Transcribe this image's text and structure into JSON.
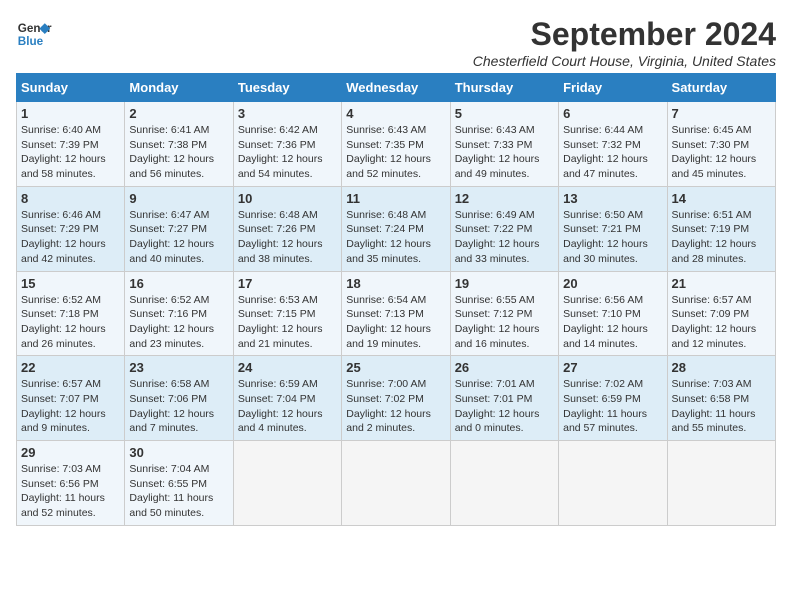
{
  "header": {
    "logo_line1": "General",
    "logo_line2": "Blue",
    "title": "September 2024",
    "subtitle": "Chesterfield Court House, Virginia, United States"
  },
  "days_of_week": [
    "Sunday",
    "Monday",
    "Tuesday",
    "Wednesday",
    "Thursday",
    "Friday",
    "Saturday"
  ],
  "weeks": [
    [
      {
        "day": "1",
        "info": "Sunrise: 6:40 AM\nSunset: 7:39 PM\nDaylight: 12 hours\nand 58 minutes."
      },
      {
        "day": "2",
        "info": "Sunrise: 6:41 AM\nSunset: 7:38 PM\nDaylight: 12 hours\nand 56 minutes."
      },
      {
        "day": "3",
        "info": "Sunrise: 6:42 AM\nSunset: 7:36 PM\nDaylight: 12 hours\nand 54 minutes."
      },
      {
        "day": "4",
        "info": "Sunrise: 6:43 AM\nSunset: 7:35 PM\nDaylight: 12 hours\nand 52 minutes."
      },
      {
        "day": "5",
        "info": "Sunrise: 6:43 AM\nSunset: 7:33 PM\nDaylight: 12 hours\nand 49 minutes."
      },
      {
        "day": "6",
        "info": "Sunrise: 6:44 AM\nSunset: 7:32 PM\nDaylight: 12 hours\nand 47 minutes."
      },
      {
        "day": "7",
        "info": "Sunrise: 6:45 AM\nSunset: 7:30 PM\nDaylight: 12 hours\nand 45 minutes."
      }
    ],
    [
      {
        "day": "8",
        "info": "Sunrise: 6:46 AM\nSunset: 7:29 PM\nDaylight: 12 hours\nand 42 minutes."
      },
      {
        "day": "9",
        "info": "Sunrise: 6:47 AM\nSunset: 7:27 PM\nDaylight: 12 hours\nand 40 minutes."
      },
      {
        "day": "10",
        "info": "Sunrise: 6:48 AM\nSunset: 7:26 PM\nDaylight: 12 hours\nand 38 minutes."
      },
      {
        "day": "11",
        "info": "Sunrise: 6:48 AM\nSunset: 7:24 PM\nDaylight: 12 hours\nand 35 minutes."
      },
      {
        "day": "12",
        "info": "Sunrise: 6:49 AM\nSunset: 7:22 PM\nDaylight: 12 hours\nand 33 minutes."
      },
      {
        "day": "13",
        "info": "Sunrise: 6:50 AM\nSunset: 7:21 PM\nDaylight: 12 hours\nand 30 minutes."
      },
      {
        "day": "14",
        "info": "Sunrise: 6:51 AM\nSunset: 7:19 PM\nDaylight: 12 hours\nand 28 minutes."
      }
    ],
    [
      {
        "day": "15",
        "info": "Sunrise: 6:52 AM\nSunset: 7:18 PM\nDaylight: 12 hours\nand 26 minutes."
      },
      {
        "day": "16",
        "info": "Sunrise: 6:52 AM\nSunset: 7:16 PM\nDaylight: 12 hours\nand 23 minutes."
      },
      {
        "day": "17",
        "info": "Sunrise: 6:53 AM\nSunset: 7:15 PM\nDaylight: 12 hours\nand 21 minutes."
      },
      {
        "day": "18",
        "info": "Sunrise: 6:54 AM\nSunset: 7:13 PM\nDaylight: 12 hours\nand 19 minutes."
      },
      {
        "day": "19",
        "info": "Sunrise: 6:55 AM\nSunset: 7:12 PM\nDaylight: 12 hours\nand 16 minutes."
      },
      {
        "day": "20",
        "info": "Sunrise: 6:56 AM\nSunset: 7:10 PM\nDaylight: 12 hours\nand 14 minutes."
      },
      {
        "day": "21",
        "info": "Sunrise: 6:57 AM\nSunset: 7:09 PM\nDaylight: 12 hours\nand 12 minutes."
      }
    ],
    [
      {
        "day": "22",
        "info": "Sunrise: 6:57 AM\nSunset: 7:07 PM\nDaylight: 12 hours\nand 9 minutes."
      },
      {
        "day": "23",
        "info": "Sunrise: 6:58 AM\nSunset: 7:06 PM\nDaylight: 12 hours\nand 7 minutes."
      },
      {
        "day": "24",
        "info": "Sunrise: 6:59 AM\nSunset: 7:04 PM\nDaylight: 12 hours\nand 4 minutes."
      },
      {
        "day": "25",
        "info": "Sunrise: 7:00 AM\nSunset: 7:02 PM\nDaylight: 12 hours\nand 2 minutes."
      },
      {
        "day": "26",
        "info": "Sunrise: 7:01 AM\nSunset: 7:01 PM\nDaylight: 12 hours\nand 0 minutes."
      },
      {
        "day": "27",
        "info": "Sunrise: 7:02 AM\nSunset: 6:59 PM\nDaylight: 11 hours\nand 57 minutes."
      },
      {
        "day": "28",
        "info": "Sunrise: 7:03 AM\nSunset: 6:58 PM\nDaylight: 11 hours\nand 55 minutes."
      }
    ],
    [
      {
        "day": "29",
        "info": "Sunrise: 7:03 AM\nSunset: 6:56 PM\nDaylight: 11 hours\nand 52 minutes."
      },
      {
        "day": "30",
        "info": "Sunrise: 7:04 AM\nSunset: 6:55 PM\nDaylight: 11 hours\nand 50 minutes."
      },
      {
        "day": "",
        "info": ""
      },
      {
        "day": "",
        "info": ""
      },
      {
        "day": "",
        "info": ""
      },
      {
        "day": "",
        "info": ""
      },
      {
        "day": "",
        "info": ""
      }
    ]
  ]
}
